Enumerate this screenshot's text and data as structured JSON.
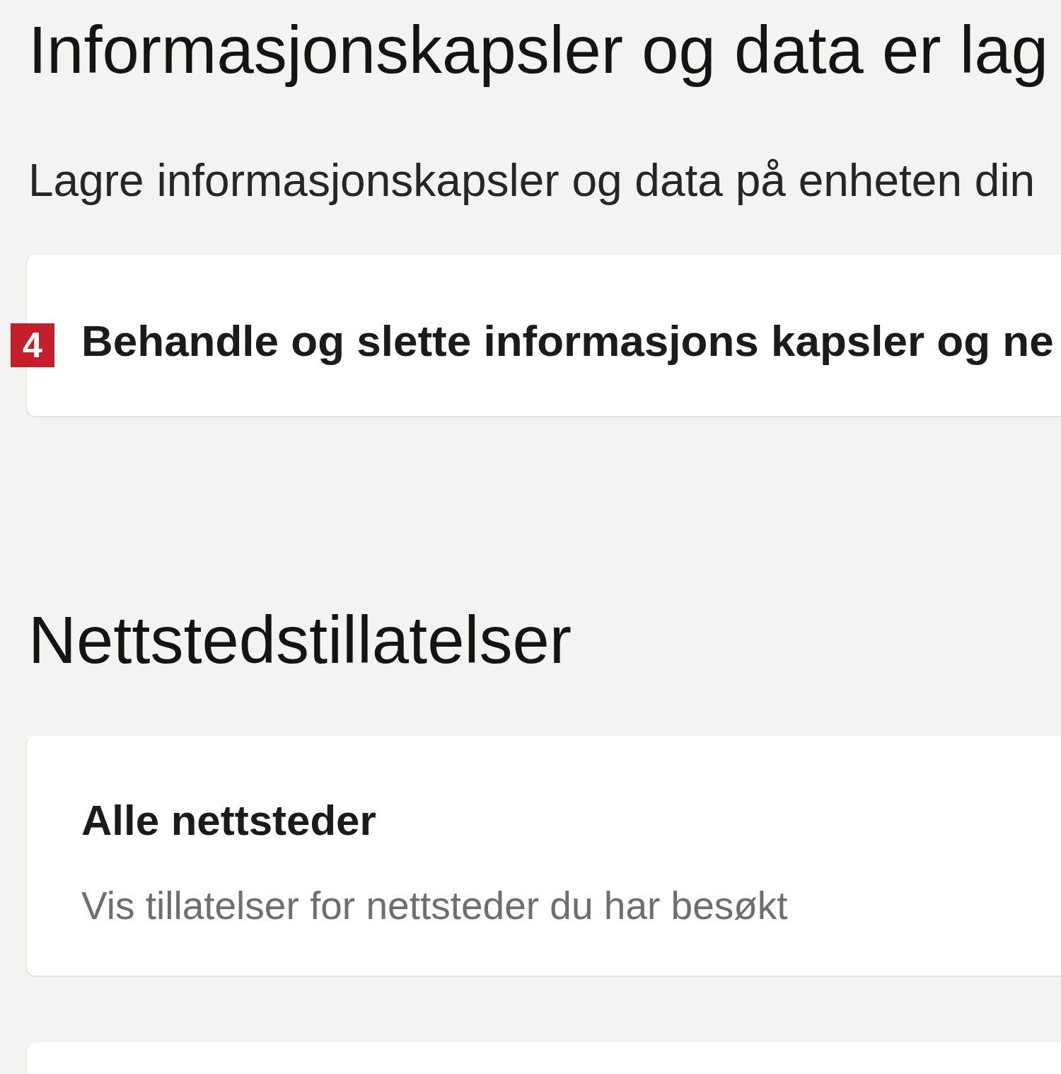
{
  "sections": [
    {
      "heading": "Informasjonskapsler og data er lag",
      "description": "Lagre informasjonskapsler og data på enheten din",
      "cards": [
        {
          "kind": "link",
          "title": "Behandle og slette informasjons kapsler og ne",
          "step_marker": "4"
        }
      ]
    },
    {
      "heading": "Nettstedstillatelser",
      "cards": [
        {
          "kind": "link",
          "title": "Alle nettsteder",
          "description": "Vis tillatelser for nettsteder du har besøkt"
        },
        {
          "kind": "cut_off"
        }
      ]
    }
  ]
}
